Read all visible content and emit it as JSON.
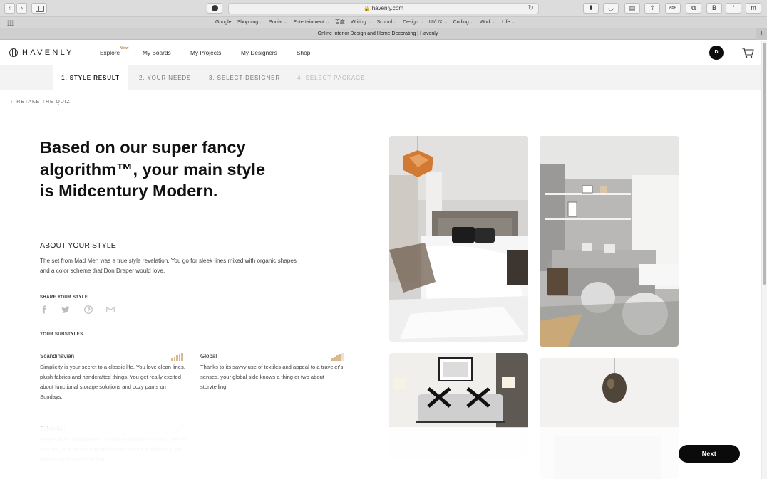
{
  "browser": {
    "url": "havenly.com",
    "tab_title": "Online Interior Design and Home Decorating | Havenly",
    "new_tab_label": "+",
    "back_glyph": "‹",
    "forward_glyph": "›",
    "lock_glyph": "🔒",
    "reload_glyph": "↻",
    "extensions": [
      {
        "name": "download-icon",
        "glyph": "⬇"
      },
      {
        "name": "pocket-icon",
        "glyph": "◡"
      },
      {
        "name": "reader-icon",
        "glyph": "▤"
      },
      {
        "name": "share-icon",
        "glyph": "⇪"
      },
      {
        "name": "adblock-icon",
        "glyph": "ABP"
      },
      {
        "name": "tabs-icon",
        "glyph": "⧉"
      },
      {
        "name": "b-extension-icon",
        "glyph": "B"
      },
      {
        "name": "person-extension-icon",
        "glyph": "ᚠ"
      },
      {
        "name": "m-extension-icon",
        "glyph": "m"
      }
    ],
    "bookmarks": [
      {
        "label": "Google",
        "dropdown": false
      },
      {
        "label": "Shopping",
        "dropdown": true
      },
      {
        "label": "Social",
        "dropdown": true
      },
      {
        "label": "Entertainment",
        "dropdown": true
      },
      {
        "label": "百度",
        "dropdown": false
      },
      {
        "label": "Writing",
        "dropdown": true
      },
      {
        "label": "School",
        "dropdown": true
      },
      {
        "label": "Design",
        "dropdown": true
      },
      {
        "label": "UI/UX",
        "dropdown": true
      },
      {
        "label": "Coding",
        "dropdown": true
      },
      {
        "label": "Work",
        "dropdown": true
      },
      {
        "label": "Life",
        "dropdown": true
      }
    ]
  },
  "header": {
    "logo_text": "HAVENLY",
    "nav": {
      "explore": "Explore",
      "explore_badge": "New!",
      "my_boards": "My Boards",
      "my_projects": "My Projects",
      "my_designers": "My Designers",
      "shop": "Shop"
    },
    "avatar_initial": "D"
  },
  "steps": [
    {
      "label": "1. STYLE RESULT",
      "state": "active"
    },
    {
      "label": "2. YOUR NEEDS",
      "state": "normal"
    },
    {
      "label": "3. SELECT DESIGNER",
      "state": "normal"
    },
    {
      "label": "4. SELECT PACKAGE",
      "state": "disabled"
    }
  ],
  "back_link": {
    "chevron": "‹",
    "label": "RETAKE THE QUIZ"
  },
  "result": {
    "headline": "Based on our super fancy algorithm™, your main style is Midcentury Modern.",
    "about_heading": "ABOUT YOUR STYLE",
    "about_text": "The set from Mad Men was a true style revelation. You go for sleek lines mixed with organic shapes and a color scheme that Don Draper would love.",
    "share_heading": "SHARE YOUR STYLE",
    "share_icons": [
      "facebook-icon",
      "twitter-icon",
      "pinterest-icon",
      "email-icon"
    ],
    "substyles_heading": "YOUR SUBSTYLES",
    "substyles": [
      {
        "name": "Scandinavian",
        "match_level": 0.9,
        "text": "Simplicity is your secret to a classic life. You love clean lines, plush fabrics and handcrafted things. You get really excited about functional storage solutions and cozy pants on Sundays."
      },
      {
        "name": "Global",
        "match_level": 0.7,
        "text": "Thanks to its savvy use of textiles and appeal to a traveler's senses, your global side knows a thing or two about storytelling!"
      },
      {
        "name": "Bohemian",
        "match_level": 0.5,
        "text": "Peace, love, and patterns. Your love of vibrant colors, layered textures, and ornate embellishments create a whimsical lair with let-down-your-hair flair."
      }
    ]
  },
  "photos": [
    "bedroom-photo",
    "living-room-photo",
    "console-table-photo",
    "pendant-lamp-photo"
  ],
  "next_button": "Next"
}
